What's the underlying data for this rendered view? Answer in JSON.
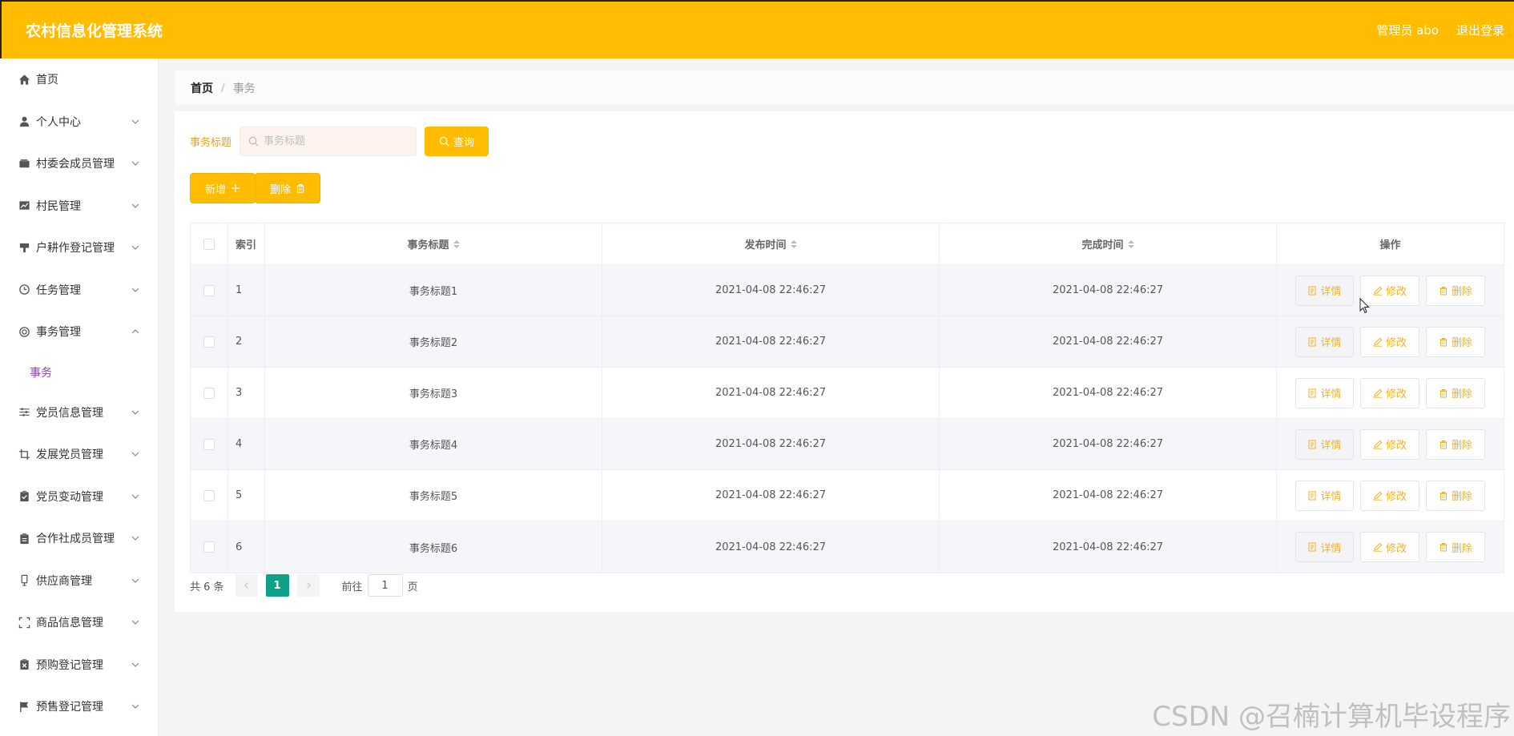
{
  "header": {
    "title": "农村信息化管理系统",
    "user": "管理员 abo",
    "logout": "退出登录"
  },
  "sidebar": {
    "items": [
      {
        "label": "首页",
        "icon": "home-icon",
        "chevron": false
      },
      {
        "label": "个人中心",
        "icon": "user-icon",
        "chevron": "down"
      },
      {
        "label": "村委会成员管理",
        "icon": "wallet-icon",
        "chevron": "down"
      },
      {
        "label": "村民管理",
        "icon": "chart-icon",
        "chevron": "down"
      },
      {
        "label": "户耕作登记管理",
        "icon": "stamp-icon",
        "chevron": "down"
      },
      {
        "label": "任务管理",
        "icon": "clock-icon",
        "chevron": "down"
      },
      {
        "label": "事务管理",
        "icon": "lifebuoy-icon",
        "chevron": "up"
      },
      {
        "label": "党员信息管理",
        "icon": "sliders-icon",
        "chevron": "down"
      },
      {
        "label": "发展党员管理",
        "icon": "crop-icon",
        "chevron": "down"
      },
      {
        "label": "党员变动管理",
        "icon": "clipboard-check-icon",
        "chevron": "down"
      },
      {
        "label": "合作社成员管理",
        "icon": "clipboard-icon",
        "chevron": "down"
      },
      {
        "label": "供应商管理",
        "icon": "device-icon",
        "chevron": "down"
      },
      {
        "label": "商品信息管理",
        "icon": "fullscreen-icon",
        "chevron": "down"
      },
      {
        "label": "预购登记管理",
        "icon": "clipboard-x-icon",
        "chevron": "down"
      },
      {
        "label": "预售登记管理",
        "icon": "flag-icon",
        "chevron": "down"
      }
    ],
    "submenu": {
      "label": "事务"
    }
  },
  "breadcrumb": {
    "home": "首页",
    "sep": "/",
    "current": "事务"
  },
  "search": {
    "label": "事务标题",
    "placeholder": "事务标题",
    "button": "查询"
  },
  "actions": {
    "add": "新增",
    "delete": "删除"
  },
  "table": {
    "headers": {
      "index": "索引",
      "title": "事务标题",
      "publish": "发布时间",
      "done": "完成时间",
      "ops": "操作"
    },
    "rows": [
      {
        "index": "1",
        "title": "事务标题1",
        "publish": "2021-04-08 22:46:27",
        "done": "2021-04-08 22:46:27"
      },
      {
        "index": "2",
        "title": "事务标题2",
        "publish": "2021-04-08 22:46:27",
        "done": "2021-04-08 22:46:27"
      },
      {
        "index": "3",
        "title": "事务标题3",
        "publish": "2021-04-08 22:46:27",
        "done": "2021-04-08 22:46:27"
      },
      {
        "index": "4",
        "title": "事务标题4",
        "publish": "2021-04-08 22:46:27",
        "done": "2021-04-08 22:46:27"
      },
      {
        "index": "5",
        "title": "事务标题5",
        "publish": "2021-04-08 22:46:27",
        "done": "2021-04-08 22:46:27"
      },
      {
        "index": "6",
        "title": "事务标题6",
        "publish": "2021-04-08 22:46:27",
        "done": "2021-04-08 22:46:27"
      }
    ],
    "ops": {
      "detail": "详情",
      "edit": "修改",
      "delete": "删除"
    }
  },
  "pagination": {
    "total": "共 6 条",
    "page": "1",
    "goto_prefix": "前往",
    "goto_value": "1",
    "goto_suffix": "页"
  },
  "watermark": "CSDN @召楠计算机毕设程序",
  "colors": {
    "primary": "#ffbc00",
    "active_submenu": "#8e44ad",
    "page_active": "#0fa08a"
  }
}
